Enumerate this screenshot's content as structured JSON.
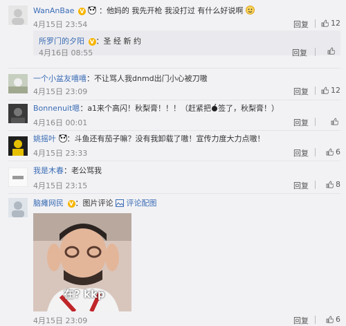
{
  "comments": [
    {
      "username": "WanAnBae",
      "separator": "：",
      "text": "他妈的 我先开枪 我没打过 有什么好说啊",
      "time": "4月15日 23:54",
      "reply": "回复",
      "likes": "12",
      "sub": {
        "username": "所罗门的夕阳",
        "separator": "：",
        "text": "圣 经 新 约",
        "time": "4月16日 08:55",
        "reply": "回复"
      }
    },
    {
      "username": "一个小盆友嘻嘻",
      "separator": "：",
      "text": "不让骂人我dnmd出门小心被刀嗷",
      "time": "4月15日 23:09",
      "reply": "回复",
      "likes": "12"
    },
    {
      "username": "Bonnenuit嗯",
      "separator": "：",
      "text": "a1来个高闪！秋梨膏！！！（赶紧把",
      "text_after": "签了，秋梨膏！）",
      "time": "4月16日 00:01",
      "reply": "回复",
      "likes": ""
    },
    {
      "username": "姚摇叶",
      "separator": "：",
      "text": "斗鱼还有茄子嘛？没有我卸载了嗷！宣传力度大力点嗷！",
      "time": "4月15日 23:33",
      "reply": "回复",
      "likes": "6"
    },
    {
      "username": "我是木春",
      "separator": "：",
      "text": "老公骂我",
      "time": "4月15日 23:15",
      "reply": "回复",
      "likes": "8"
    },
    {
      "username": "脑瘫网民",
      "separator": "：",
      "pic_label": "图片评论",
      "pic_link": "评论配图",
      "image_caption": "在? kkp",
      "time": "4月15日 23:09",
      "reply": "回复",
      "likes": "6"
    }
  ],
  "colors": {
    "username": "#3a6cb4",
    "background": "#f2f2f5",
    "meta": "#888888"
  },
  "icons": {
    "like": "thumbs-up-icon",
    "vip": "crown-badge-icon",
    "pic": "image-icon"
  }
}
